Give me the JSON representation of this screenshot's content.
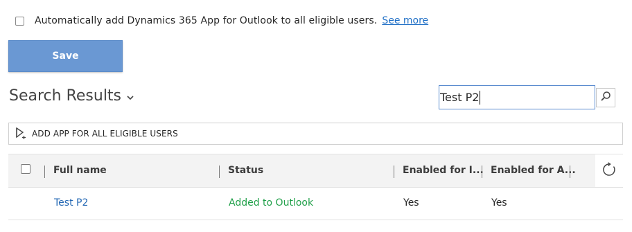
{
  "auto_add": {
    "checked": false,
    "label": "Automatically add Dynamics 365 App for Outlook to all eligible users.",
    "see_more": "See more"
  },
  "save_label": "Save",
  "results": {
    "title": "Search Results",
    "search_value": "Test P2",
    "search_icon": "search-icon"
  },
  "command_bar": {
    "add_app_label": "ADD APP FOR ALL ELIGIBLE USERS",
    "icon": "add-app-icon"
  },
  "grid": {
    "columns": [
      "Full name",
      "Status",
      "Enabled for I...",
      "Enabled for A..."
    ],
    "rows": [
      {
        "full_name": "Test P2",
        "status": "Added to Outlook",
        "enabled_i": "Yes",
        "enabled_a": "Yes"
      }
    ],
    "refresh_icon": "refresh-icon"
  },
  "colors": {
    "accent": "#6a98d3",
    "link": "#2468b4",
    "status_green": "#21a04a",
    "search_border": "#5a8ccf"
  }
}
